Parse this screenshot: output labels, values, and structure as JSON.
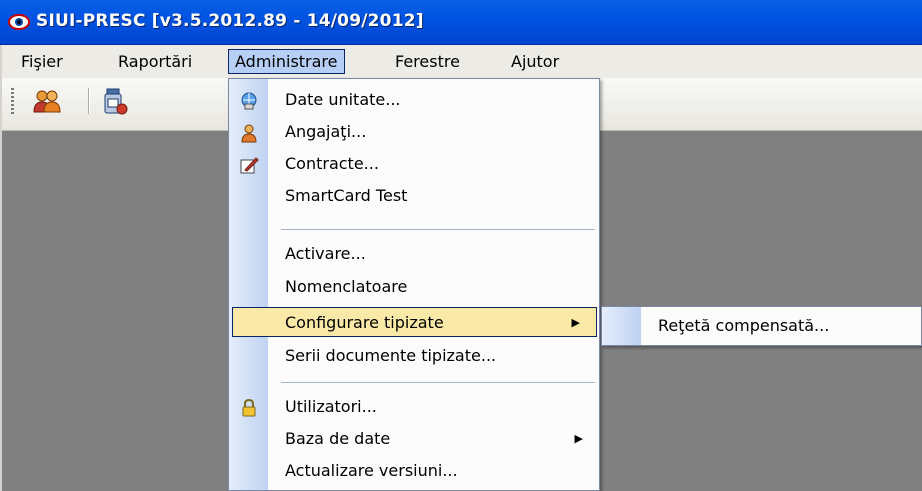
{
  "window": {
    "title": "SIUI-PRESC [v3.5.2012.89 - 14/09/2012]",
    "icon": "eye-logo-icon"
  },
  "menubar": {
    "items": [
      {
        "label": "Fişier"
      },
      {
        "label": "Raportări"
      },
      {
        "label": "Administrare"
      },
      {
        "label": "Ferestre"
      },
      {
        "label": "Ajutor"
      }
    ],
    "active": "Administrare"
  },
  "toolbar": {
    "buttons": [
      {
        "icon": "users-icon"
      },
      {
        "icon": "medicine-bottle-icon"
      }
    ]
  },
  "administrare_menu": {
    "items": [
      {
        "label": "Date unitate...",
        "icon": "globe-database-icon"
      },
      {
        "label": "Angajaţi...",
        "icon": "person-icon"
      },
      {
        "label": "Contracte...",
        "icon": "edit-document-icon"
      },
      {
        "label": "SmartCard Test"
      },
      {
        "label": "Activare..."
      },
      {
        "label": "Nomenclatoare"
      },
      {
        "label": "Configurare tipizate",
        "submenu": true,
        "highlighted": true
      },
      {
        "label": "Serii documente tipizate..."
      },
      {
        "label": "Utilizatori...",
        "icon": "padlock-icon"
      },
      {
        "label": "Baza de date",
        "submenu": true
      },
      {
        "label": "Actualizare versiuni..."
      }
    ]
  },
  "submenu_configurare_tipizate": {
    "items": [
      {
        "label": "Reţetă compensată..."
      }
    ]
  },
  "colors": {
    "titlebar": "#0054e3",
    "menu_highlight": "#fbe9a8",
    "menu_active": "#b6cff6",
    "desktop": "#808080"
  }
}
